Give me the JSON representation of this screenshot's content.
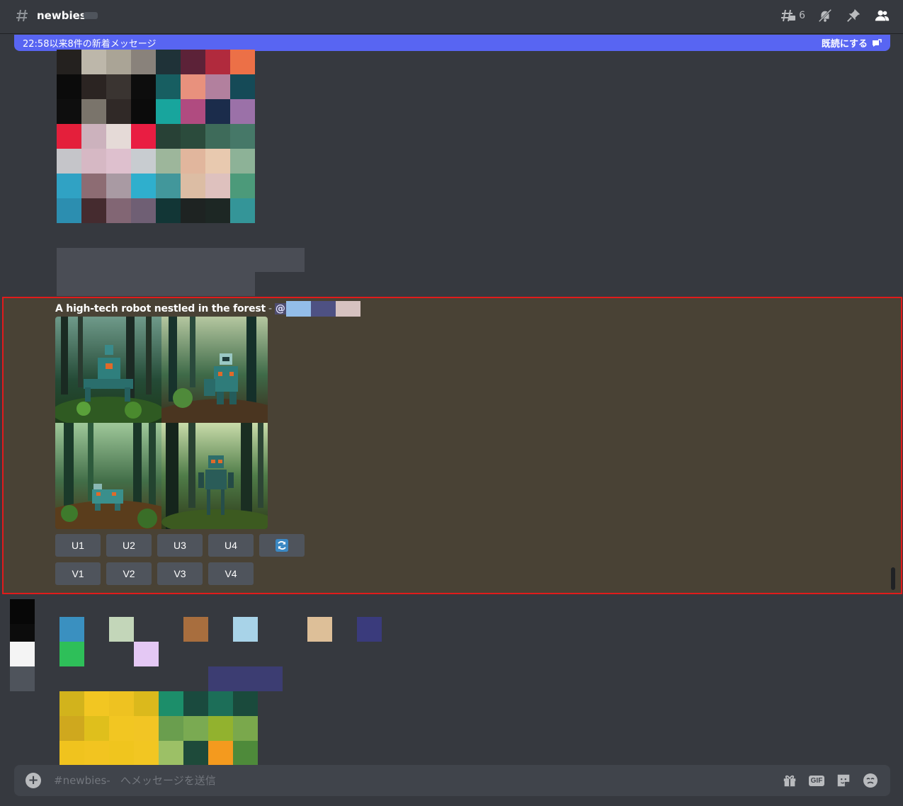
{
  "header": {
    "channel_name": "newbies",
    "thread_count": "6"
  },
  "new_messages_bar": {
    "text": "22:58以来8件の新着メッセージ",
    "mark_read": "既読にする"
  },
  "message": {
    "prompt": "A high-tech robot nestled in the forest",
    "separator": "-",
    "mention_prefix": "@",
    "buttons_upscale": [
      "U1",
      "U2",
      "U3",
      "U4"
    ],
    "buttons_variation": [
      "V1",
      "V2",
      "V3",
      "V4"
    ],
    "refresh_icon": "refresh-icon"
  },
  "composer": {
    "placeholder": "#newbies-   へメッセージを送信"
  },
  "colors": {
    "highlight_border": "#e01b1b",
    "new_bar": "#5865f2",
    "background": "#36393f"
  }
}
